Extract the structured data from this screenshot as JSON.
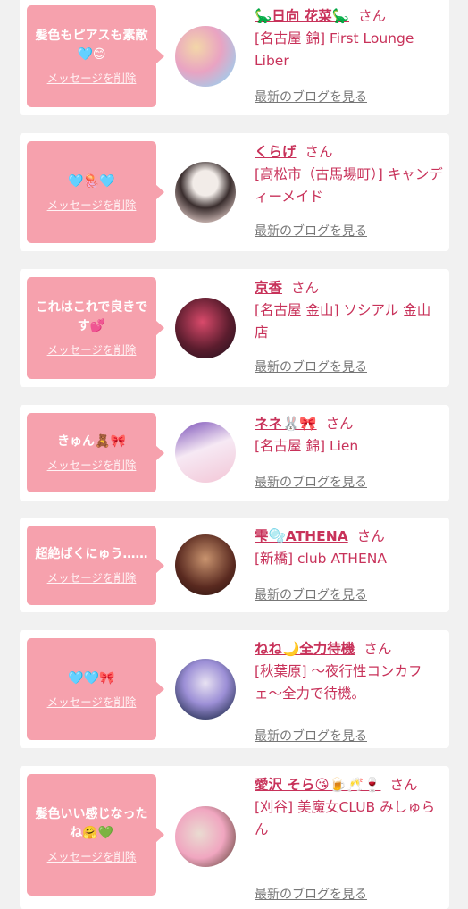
{
  "common": {
    "delete_label": "メッセージを削除",
    "blog_label": "最新のブログを見る",
    "san": "さん"
  },
  "cards": [
    {
      "message": "髪色もピアスも素敵🩵😊",
      "name": "🦕日向 花菜🦕",
      "shop": "[名古屋 錦] First Lounge Liber",
      "avatar_colors": [
        "#e9a3c2",
        "#f3d7a8",
        "#a7c9e8"
      ]
    },
    {
      "message": "🩵🪼🩵",
      "name": "くらげ",
      "shop": "[高松市（古馬場町）] キャンディーメイド",
      "avatar_colors": [
        "#f2ece8",
        "#3a2e2e",
        "#d8c3bf"
      ]
    },
    {
      "message": "これはこれで良きです💕",
      "name": "京香",
      "shop": "[名古屋 金山] ソシアル 金山店",
      "avatar_colors": [
        "#5c1d2e",
        "#d94a6b",
        "#2a1320"
      ]
    },
    {
      "message": "きゅん🧸🎀",
      "name": "ネネ🐰🎀",
      "shop": "[名古屋 錦] Lien",
      "avatar_colors": [
        "#f6e9f4",
        "#7a4fb8",
        "#f3c6d6"
      ]
    },
    {
      "message": "超絶ばくにゅう……",
      "name": "雫🫧ATHENA",
      "shop": "[新橋] club ATHENA",
      "avatar_colors": [
        "#5a2a20",
        "#c9946f",
        "#2b1410"
      ]
    },
    {
      "message": "🩵🩵🎀",
      "name": "ねね🌙全力待機",
      "shop": "[秋葉原] 〜夜行性コンカフェ〜全力で待機。",
      "avatar_colors": [
        "#1e2a4a",
        "#9c8fd6",
        "#e8e2f2"
      ]
    },
    {
      "message": "髪色いい感じなったね🤗💚",
      "name": "愛沢 そら😘🍺🥂🍷",
      "shop": "[刈谷] 美魔女CLUB みしゅらん",
      "avatar_colors": [
        "#eadbd1",
        "#f0a6c0",
        "#5c4034"
      ]
    }
  ]
}
